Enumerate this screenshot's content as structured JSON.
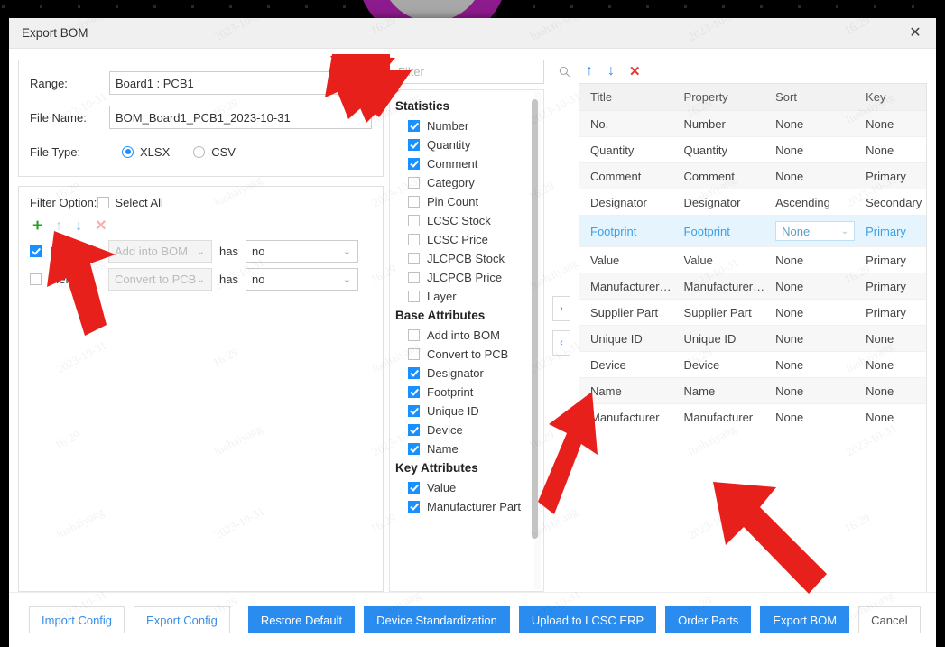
{
  "window": {
    "title": "Export BOM",
    "close_icon": "close-icon"
  },
  "form": {
    "range_label": "Range:",
    "range_value": "Board1 : PCB1",
    "filename_label": "File Name:",
    "filename_value": "BOM_Board1_PCB1_2023-10-31",
    "filetype_label": "File Type:",
    "filetype_options": [
      {
        "label": "XLSX",
        "selected": true
      },
      {
        "label": "CSV",
        "selected": false
      }
    ]
  },
  "filter_option": {
    "label": "Filter Option:",
    "select_all_label": "Select All",
    "select_all_checked": false,
    "tools": [
      {
        "name": "add-filter-icon",
        "glyph": "+"
      },
      {
        "name": "move-up-icon",
        "glyph": "↑"
      },
      {
        "name": "move-down-icon",
        "glyph": "↓"
      },
      {
        "name": "delete-filter-icon",
        "glyph": "✕"
      }
    ],
    "has_label": "has",
    "rows": [
      {
        "checked": true,
        "action": "Remove",
        "field": "Add into BOM",
        "field_disabled": true,
        "value": "no"
      },
      {
        "checked": false,
        "action": "Remove",
        "field": "Convert to PCB",
        "field_disabled": true,
        "value": "no"
      }
    ]
  },
  "attributes_panel": {
    "search_placeholder": "Filter",
    "search_value": "",
    "search_icon": "search-icon",
    "groups": [
      {
        "title": "Statistics",
        "items": [
          {
            "label": "Number",
            "checked": true
          },
          {
            "label": "Quantity",
            "checked": true
          },
          {
            "label": "Comment",
            "checked": true
          },
          {
            "label": "Category",
            "checked": false
          },
          {
            "label": "Pin Count",
            "checked": false
          },
          {
            "label": "LCSC Stock",
            "checked": false
          },
          {
            "label": "LCSC Price",
            "checked": false
          },
          {
            "label": "JLCPCB Stock",
            "checked": false
          },
          {
            "label": "JLCPCB Price",
            "checked": false
          },
          {
            "label": "Layer",
            "checked": false
          }
        ]
      },
      {
        "title": "Base Attributes",
        "items": [
          {
            "label": "Add into BOM",
            "checked": false
          },
          {
            "label": "Convert to PCB",
            "checked": false
          },
          {
            "label": "Designator",
            "checked": true
          },
          {
            "label": "Footprint",
            "checked": true
          },
          {
            "label": "Unique ID",
            "checked": true
          },
          {
            "label": "Device",
            "checked": true
          },
          {
            "label": "Name",
            "checked": true
          }
        ]
      },
      {
        "title": "Key Attributes",
        "items": [
          {
            "label": "Value",
            "checked": true
          },
          {
            "label": "Manufacturer Part",
            "checked": true
          }
        ]
      }
    ]
  },
  "transfer": {
    "to_right_label": "›",
    "to_left_label": "‹"
  },
  "table_tools": [
    {
      "name": "row-move-up-icon",
      "glyph": "↑"
    },
    {
      "name": "row-move-down-icon",
      "glyph": "↓"
    },
    {
      "name": "row-delete-icon",
      "glyph": "✕"
    }
  ],
  "table": {
    "headers": [
      "Title",
      "Property",
      "Sort",
      "Key"
    ],
    "rows": [
      {
        "title": "No.",
        "property": "Number",
        "sort": "None",
        "key": "None",
        "selected": false
      },
      {
        "title": "Quantity",
        "property": "Quantity",
        "sort": "None",
        "key": "None",
        "selected": false
      },
      {
        "title": "Comment",
        "property": "Comment",
        "sort": "None",
        "key": "Primary",
        "selected": false
      },
      {
        "title": "Designator",
        "property": "Designator",
        "sort": "Ascending",
        "key": "Secondary",
        "selected": false
      },
      {
        "title": "Footprint",
        "property": "Footprint",
        "sort": "None",
        "key": "Primary",
        "selected": true
      },
      {
        "title": "Value",
        "property": "Value",
        "sort": "None",
        "key": "Primary",
        "selected": false
      },
      {
        "title": "Manufacturer…",
        "property": "Manufacturer…",
        "sort": "None",
        "key": "Primary",
        "selected": false
      },
      {
        "title": "Supplier Part",
        "property": "Supplier Part",
        "sort": "None",
        "key": "Primary",
        "selected": false
      },
      {
        "title": "Unique ID",
        "property": "Unique ID",
        "sort": "None",
        "key": "None",
        "selected": false
      },
      {
        "title": "Device",
        "property": "Device",
        "sort": "None",
        "key": "None",
        "selected": false
      },
      {
        "title": "Name",
        "property": "Name",
        "sort": "None",
        "key": "None",
        "selected": false
      },
      {
        "title": "Manufacturer",
        "property": "Manufacturer",
        "sort": "None",
        "key": "None",
        "selected": false
      }
    ]
  },
  "footer": {
    "import_config": "Import Config",
    "export_config": "Export Config",
    "restore_default": "Restore Default",
    "device_standardization": "Device Standardization",
    "upload_lcsc": "Upload to LCSC ERP",
    "order_parts": "Order Parts",
    "export_bom": "Export BOM",
    "cancel": "Cancel"
  },
  "watermarks": [
    "luohaiyang",
    "2023-10-31",
    "16:29"
  ],
  "colors": {
    "accent": "#2b8cf0",
    "checkbox_on": "#1890ff",
    "selected_row_bg": "#e6f4fd",
    "selected_row_text": "#3ba0e8",
    "annotation_arrow": "#e8201c",
    "background_arc": "#8e1b8e"
  }
}
